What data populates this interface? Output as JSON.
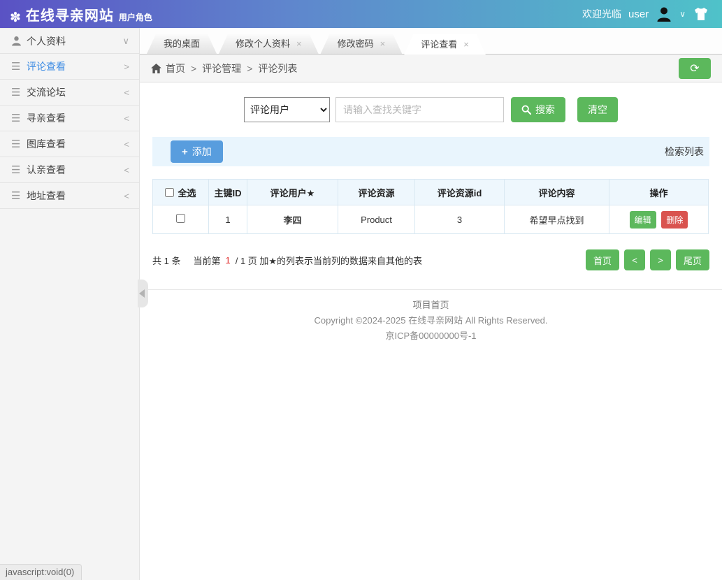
{
  "header": {
    "logo_glyph": "✽",
    "title": "在线寻亲网站",
    "subtitle": "用户角色",
    "welcome": "欢迎光临",
    "username": "user",
    "chevron": "∨"
  },
  "sidebar": {
    "items": [
      {
        "label": "个人资料",
        "arrow": "∨",
        "active": false
      },
      {
        "label": "评论查看",
        "arrow": ">",
        "active": true
      },
      {
        "label": "交流论坛",
        "arrow": "<",
        "active": false
      },
      {
        "label": "寻亲查看",
        "arrow": "<",
        "active": false
      },
      {
        "label": "图库查看",
        "arrow": "<",
        "active": false
      },
      {
        "label": "认亲查看",
        "arrow": "<",
        "active": false
      },
      {
        "label": "地址查看",
        "arrow": "<",
        "active": false
      }
    ],
    "menu_glyph": "☰"
  },
  "tabbar": {
    "close_glyph": "×",
    "tabs": [
      {
        "label": "我的桌面",
        "closable": false,
        "active": false
      },
      {
        "label": "修改个人资料",
        "closable": true,
        "active": false
      },
      {
        "label": "修改密码",
        "closable": true,
        "active": false
      },
      {
        "label": "评论查看",
        "closable": true,
        "active": true
      }
    ]
  },
  "breadcrumb": {
    "home": "首页",
    "sep": ">",
    "level2": "评论管理",
    "level3": "评论列表"
  },
  "search": {
    "field_selected": "评论用户",
    "placeholder": "请输入查找关键字",
    "search_label": "搜索",
    "clear_label": "清空"
  },
  "toolbar": {
    "add_plus": "+",
    "add_label": "添加",
    "list_label": "检索列表"
  },
  "table": {
    "headers": {
      "select_all": "全选",
      "id": "主键ID",
      "user": "评论用户★",
      "resource": "评论资源",
      "resource_id": "评论资源id",
      "content": "评论内容",
      "operate": "操作"
    },
    "rows": [
      {
        "id": "1",
        "user": "李四",
        "resource": "Product",
        "resource_id": "3",
        "content": "希望早点找到",
        "edit_label": "编辑",
        "delete_label": "删除"
      }
    ]
  },
  "pagination": {
    "total_text": "共 1 条",
    "current_prefix": "当前第",
    "current_page": "1",
    "current_suffix": "/ 1 页 加★的列表示当前列的数据来自其他的表",
    "first_label": "首页",
    "prev_label": "<",
    "next_label": ">",
    "last_label": "尾页"
  },
  "footer": {
    "line1": "项目首页",
    "line2": "Copyright ©2024-2025 在线寻亲网站 All Rights Reserved.",
    "line3": "京ICP备00000000号-1"
  },
  "statusbar": {
    "text": "javascript:void(0)"
  },
  "colors": {
    "header_gradient_left": "#5a52c4",
    "header_gradient_mid": "#5f86cd",
    "header_gradient_right": "#4fc2c9",
    "green": "#5cb85c",
    "blue": "#589dde",
    "red": "#d9534f",
    "red_text": "#cc3333",
    "toolbar_bg": "#e9f5fd",
    "table_header_bg": "#eef7fd",
    "table_border": "#d9e8f2",
    "sidebar_bg": "#f4f4f4",
    "active_link": "#3d8ce4"
  }
}
